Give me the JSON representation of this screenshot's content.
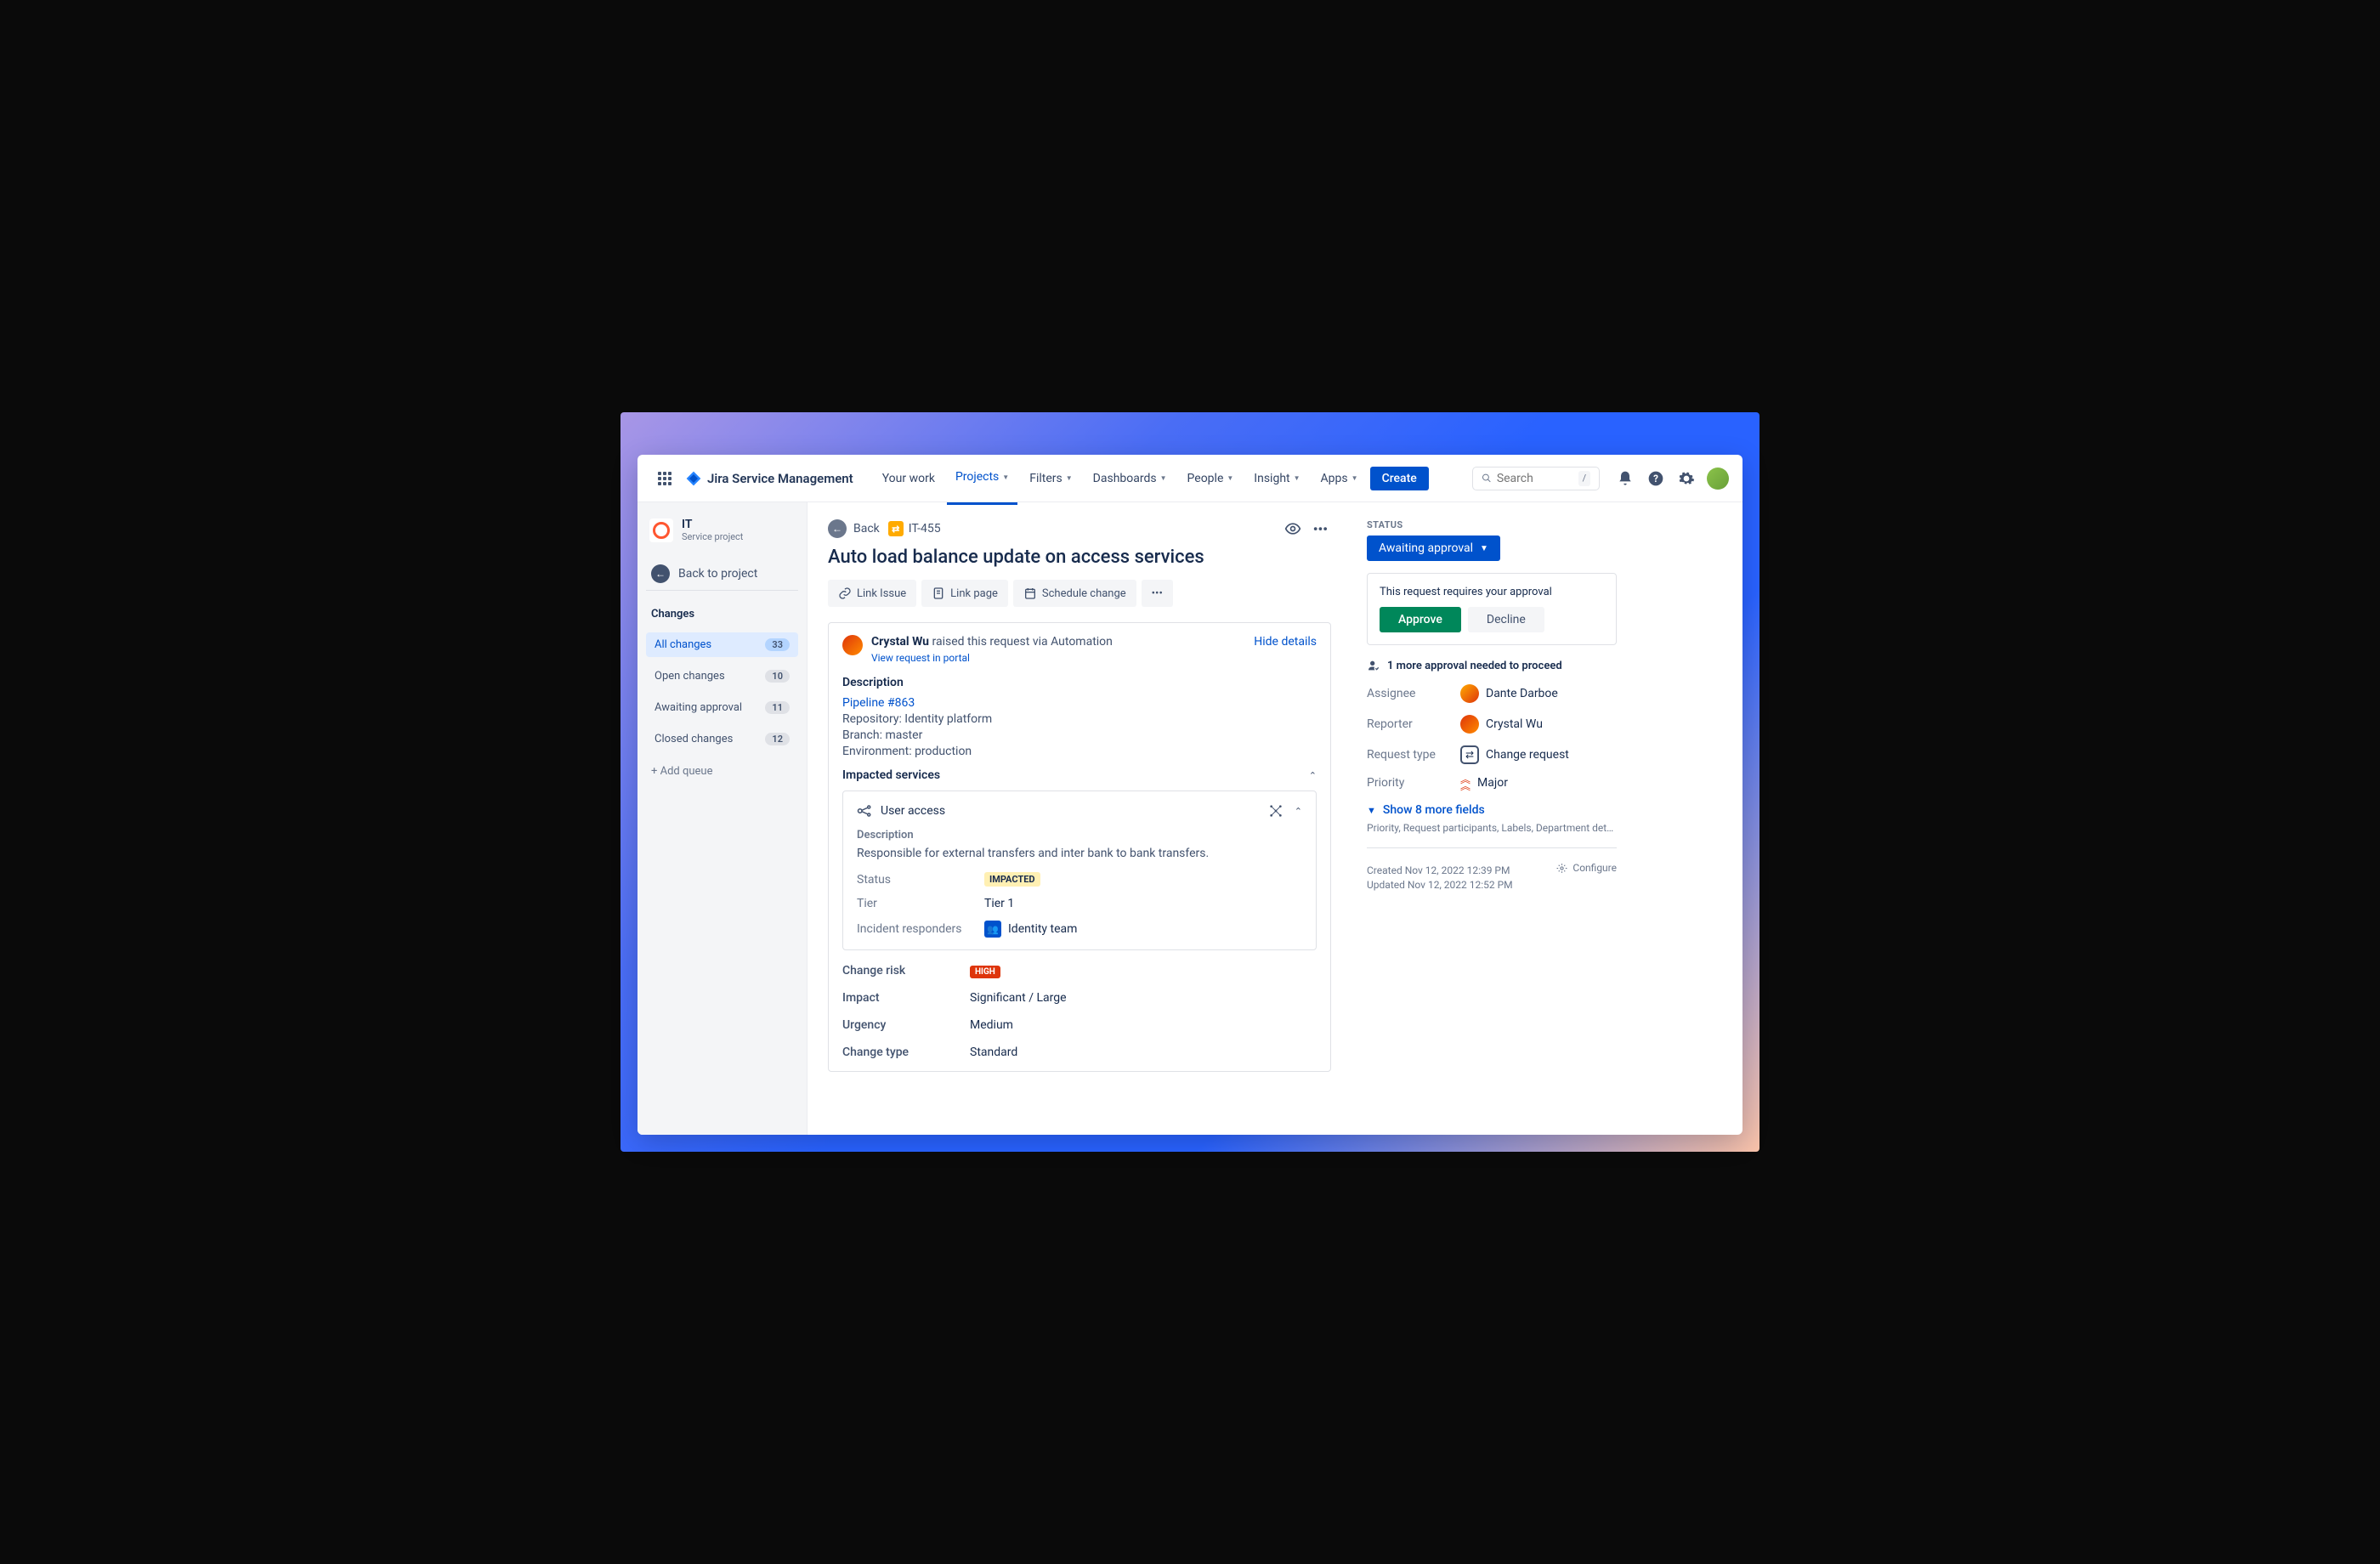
{
  "brand": "Jira Service Management",
  "nav": {
    "your_work": "Your work",
    "projects": "Projects",
    "filters": "Filters",
    "dashboards": "Dashboards",
    "people": "People",
    "insight": "Insight",
    "apps": "Apps",
    "create": "Create"
  },
  "search": {
    "placeholder": "Search",
    "kbd": "/"
  },
  "sidebar": {
    "project_name": "IT",
    "project_sub": "Service project",
    "back": "Back to project",
    "section": "Changes",
    "items": [
      {
        "label": "All changes",
        "count": "33"
      },
      {
        "label": "Open changes",
        "count": "10"
      },
      {
        "label": "Awaiting approval",
        "count": "11"
      },
      {
        "label": "Closed changes",
        "count": "12"
      }
    ],
    "add_queue": "+ Add queue"
  },
  "issue": {
    "back": "Back",
    "key": "IT-455",
    "title": "Auto load balance update on access services",
    "actions": {
      "link_issue": "Link Issue",
      "link_page": "Link page",
      "schedule": "Schedule change"
    },
    "requester_name": "Crystal Wu",
    "requester_suffix": " raised this request via Automation",
    "portal": "View request in portal",
    "hide": "Hide details",
    "desc_label": "Description",
    "pipeline": "Pipeline #863",
    "repo": "Repository: Identity platform",
    "branch": "Branch: master",
    "env": "Environment: production",
    "impacted_label": "Impacted services",
    "service": {
      "name": "User access",
      "desc_label": "Description",
      "desc": "Responsible for external transfers and inter bank to bank transfers.",
      "status_k": "Status",
      "status_v": "IMPACTED",
      "tier_k": "Tier",
      "tier_v": "Tier 1",
      "resp_k": "Incident responders",
      "resp_v": "Identity team"
    },
    "risk_k": "Change risk",
    "risk_v": "HIGH",
    "impact_k": "Impact",
    "impact_v": "Significant / Large",
    "urgency_k": "Urgency",
    "urgency_v": "Medium",
    "changetype_k": "Change type",
    "changetype_v": "Standard"
  },
  "right": {
    "status_label": "STATUS",
    "status": "Awaiting approval",
    "approval_msg": "This request requires your approval",
    "approve": "Approve",
    "decline": "Decline",
    "needed": "1 more approval needed to proceed",
    "assignee_k": "Assignee",
    "assignee_v": "Dante Darboe",
    "reporter_k": "Reporter",
    "reporter_v": "Crystal Wu",
    "reqtype_k": "Request type",
    "reqtype_v": "Change request",
    "priority_k": "Priority",
    "priority_v": "Major",
    "show_more": "Show 8 more fields",
    "more_hint": "Priority, Request participants, Labels, Department details, Organizations, T...",
    "created": "Created Nov 12, 2022 12:39 PM",
    "updated": "Updated Nov 12, 2022 12:52 PM",
    "configure": "Configure"
  }
}
